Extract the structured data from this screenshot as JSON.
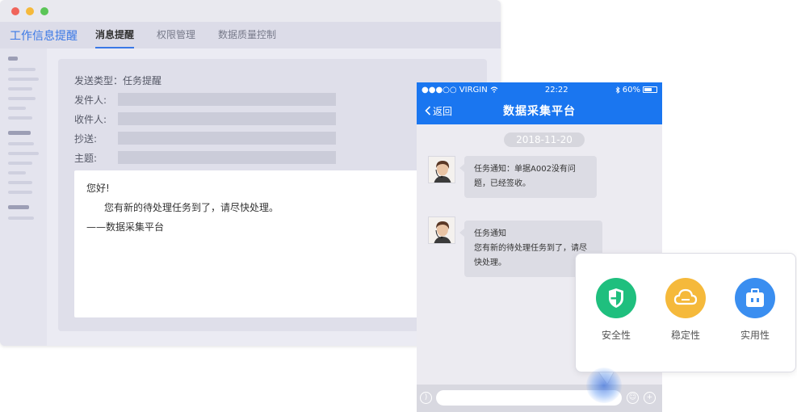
{
  "desktop": {
    "brand": "工作信息提醒",
    "tabs": [
      {
        "label": "消息提醒",
        "active": true
      },
      {
        "label": "权限管理",
        "active": false
      },
      {
        "label": "数据质量控制",
        "active": false
      }
    ],
    "form": {
      "send_type": "发送类型：任务提醒",
      "from_label": "发件人:",
      "to_label": "收件人:",
      "cc_label": "抄送:",
      "subject_label": "主题:"
    },
    "message": {
      "greeting": "您好!",
      "body": "您有新的待处理任务到了，请尽快处理。",
      "signature": "——数据采集平台"
    }
  },
  "phone": {
    "status": {
      "carrier": "●●●○○ VIRGIN",
      "time": "22:22",
      "battery": "60%"
    },
    "back_label": "返回",
    "title": "数据采集平台",
    "date": "2018-11-20",
    "messages": [
      {
        "text": "任务通知：单据A002没有问题，已经签收。"
      },
      {
        "title": "任务通知",
        "text": "您有新的待处理任务到了，请尽快处理。"
      }
    ]
  },
  "features": [
    {
      "label": "安全性",
      "icon": "shield-icon",
      "color": "#1fbf7e"
    },
    {
      "label": "稳定性",
      "icon": "cloud-icon",
      "color": "#f5b93b"
    },
    {
      "label": "实用性",
      "icon": "toolbox-icon",
      "color": "#3a8ef0"
    }
  ],
  "colors": {
    "accent": "#3a78e6",
    "phone_bar": "#1a76f0"
  }
}
